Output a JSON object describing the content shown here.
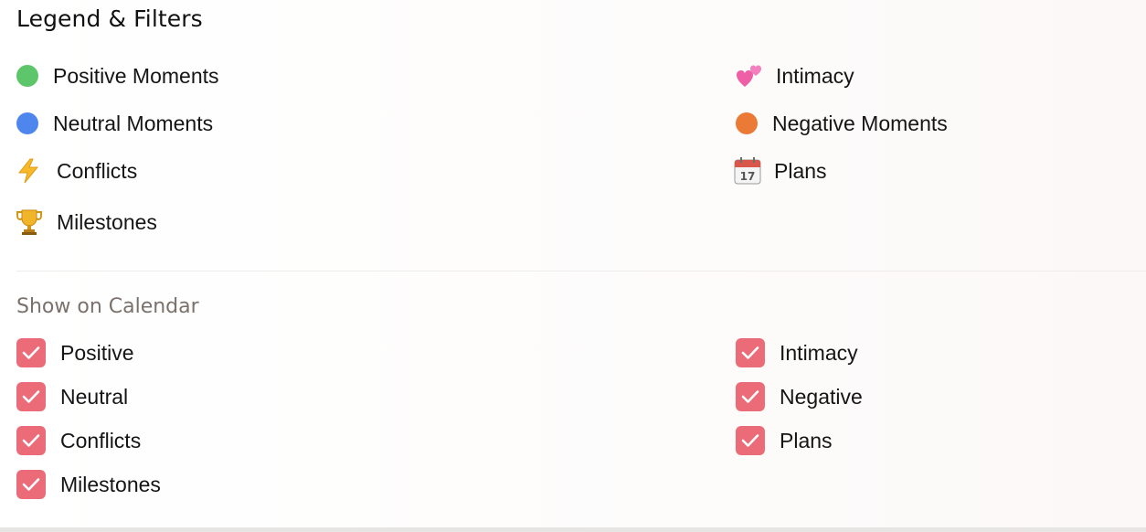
{
  "header": {
    "title": "Legend & Filters"
  },
  "legend": {
    "items": [
      {
        "label": "Positive Moments",
        "icon": "green-dot-icon",
        "color": "#5dc56a"
      },
      {
        "label": "Intimacy",
        "icon": "two-hearts-icon",
        "color": "#ee5fa6"
      },
      {
        "label": "Neutral Moments",
        "icon": "blue-dot-icon",
        "color": "#4f86ee"
      },
      {
        "label": "Negative Moments",
        "icon": "orange-dot-icon",
        "color": "#ec7a37"
      },
      {
        "label": "Conflicts",
        "icon": "lightning-icon",
        "color": "#f6b929"
      },
      {
        "label": "Plans",
        "icon": "calendar-icon",
        "color": "#d9574a"
      },
      {
        "label": "Milestones",
        "icon": "trophy-icon",
        "color": "#e0a020"
      }
    ]
  },
  "filters": {
    "title": "Show on Calendar",
    "checkbox_color": "#ec6b78",
    "options": [
      {
        "label": "Positive",
        "checked": true
      },
      {
        "label": "Intimacy",
        "checked": true
      },
      {
        "label": "Neutral",
        "checked": true
      },
      {
        "label": "Negative",
        "checked": true
      },
      {
        "label": "Conflicts",
        "checked": true
      },
      {
        "label": "Plans",
        "checked": true
      },
      {
        "label": "Milestones",
        "checked": true
      }
    ]
  }
}
